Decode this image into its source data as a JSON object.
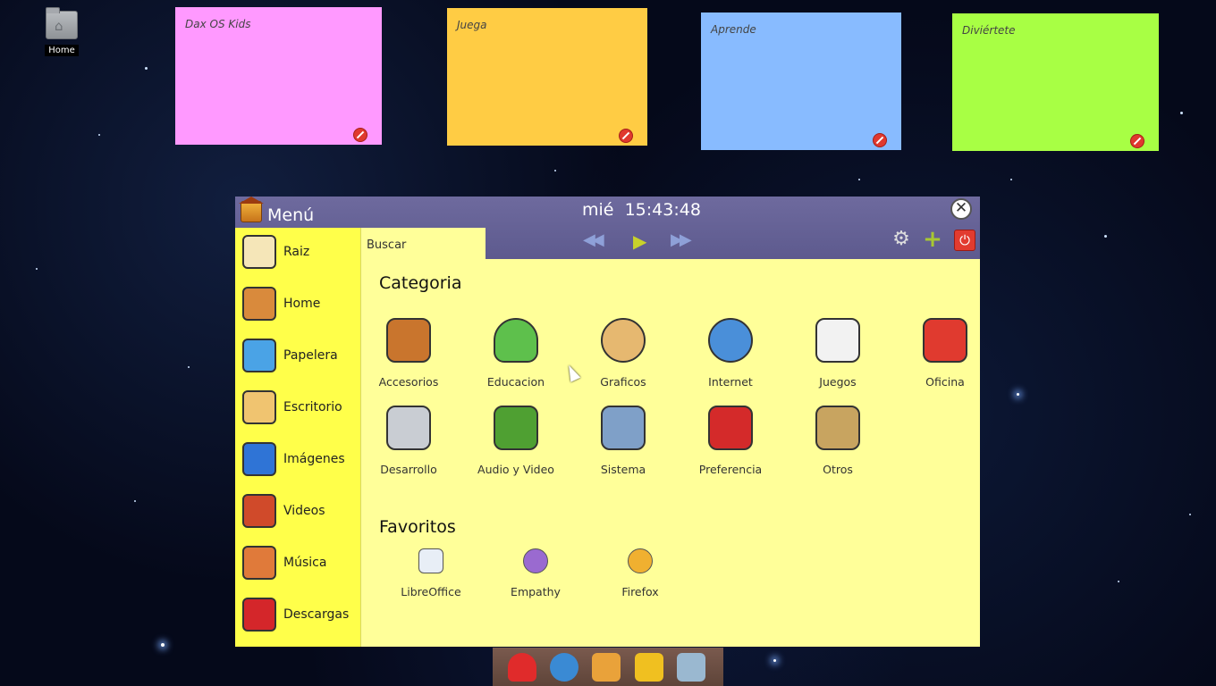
{
  "desktop": {
    "home_label": "Home"
  },
  "notes": [
    {
      "title": "Dax OS Kids",
      "color": "#ff99ff"
    },
    {
      "title": "Juega",
      "color": "#ffcc44"
    },
    {
      "title": "Aprende",
      "color": "#88bbff"
    },
    {
      "title": "Diviértete",
      "color": "#a8ff44"
    }
  ],
  "menu": {
    "title": "Menú",
    "day": "mié",
    "time": "15:43:48",
    "search_tab": "Buscar",
    "sidebar": [
      {
        "label": "Raiz",
        "icon": "hard-drive-icon",
        "color": "#f5e6b8"
      },
      {
        "label": "Home",
        "icon": "house-icon",
        "color": "#d98a3c"
      },
      {
        "label": "Papelera",
        "icon": "trash-icon",
        "color": "#4aa3e6"
      },
      {
        "label": "Escritorio",
        "icon": "desk-icon",
        "color": "#f0c470"
      },
      {
        "label": "Imágenes",
        "icon": "images-folder-icon",
        "color": "#2f74d6"
      },
      {
        "label": "Videos",
        "icon": "film-icon",
        "color": "#d04a2a"
      },
      {
        "label": "Música",
        "icon": "radio-icon",
        "color": "#e07a3a"
      },
      {
        "label": "Descargas",
        "icon": "downloads-folder-icon",
        "color": "#d4262a"
      }
    ],
    "categoria_title": "Categoria",
    "categories": [
      {
        "label": "Accesorios",
        "icon": "books-icon",
        "color": "#c9752d"
      },
      {
        "label": "Educacion",
        "icon": "flask-icon",
        "color": "#5ec04c"
      },
      {
        "label": "Graficos",
        "icon": "palette-icon",
        "color": "#e6b870"
      },
      {
        "label": "Internet",
        "icon": "globe-icon",
        "color": "#4a8fd9"
      },
      {
        "label": "Juegos",
        "icon": "dice-icon",
        "color": "#f2f2f2"
      },
      {
        "label": "Oficina",
        "icon": "telephone-icon",
        "color": "#e03a2f"
      },
      {
        "label": "Desarrollo",
        "icon": "trowel-icon",
        "color": "#c9cdd3"
      },
      {
        "label": "Audio y Video",
        "icon": "music-film-icon",
        "color": "#4fa032"
      },
      {
        "label": "Sistema",
        "icon": "monitor-tools-icon",
        "color": "#7fa0c8"
      },
      {
        "label": "Preferencia",
        "icon": "swiss-knife-icon",
        "color": "#d42a2a"
      },
      {
        "label": "Otros",
        "icon": "tools-icon",
        "color": "#c8a460"
      }
    ],
    "favoritos_title": "Favoritos",
    "favorites": [
      {
        "label": "LibreOffice",
        "icon": "libreoffice-icon",
        "color": "#e8eef6"
      },
      {
        "label": "Empathy",
        "icon": "empathy-icon",
        "color": "#9a6ad0"
      },
      {
        "label": "Firefox",
        "icon": "firefox-icon",
        "color": "#f0b030"
      }
    ]
  },
  "dock": [
    {
      "icon": "heart-icon",
      "color": "#e02b2b"
    },
    {
      "icon": "globe-icon",
      "color": "#3a8ad4"
    },
    {
      "icon": "home-icon",
      "color": "#e9a23a"
    },
    {
      "icon": "flags-icon",
      "color": "#f0c020"
    },
    {
      "icon": "trash-icon",
      "color": "#9ab8d0"
    }
  ]
}
